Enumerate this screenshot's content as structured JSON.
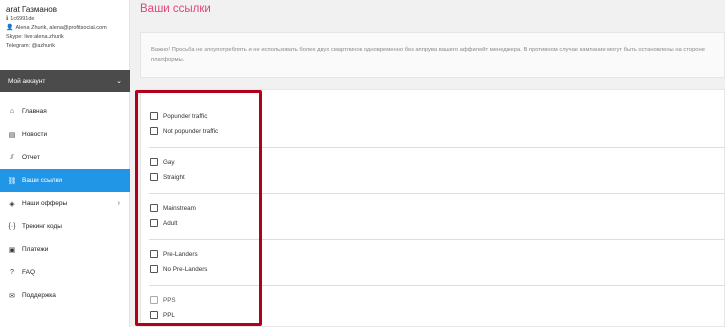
{
  "profile": {
    "name": "arat Газманов",
    "id": "1c6991de",
    "contact": "Alena Zhurik, alena@profitsocial.com",
    "skype": "Skype: live:alena.zhurik",
    "telegram": "Telegram: @azhurik"
  },
  "account": {
    "label": "Мой аккаунт"
  },
  "menu": [
    {
      "label": "Главная",
      "icon": "home-icon",
      "glyph": "⌂"
    },
    {
      "label": "Новости",
      "icon": "news-icon",
      "glyph": "▤"
    },
    {
      "label": "Отчет",
      "icon": "chart-icon",
      "glyph": "⫽"
    },
    {
      "label": "Ваши ссылки",
      "icon": "link-icon",
      "glyph": "⛓"
    },
    {
      "label": "Наши офферы",
      "icon": "offers-icon",
      "glyph": "◈"
    },
    {
      "label": "Трекинг коды",
      "icon": "code-icon",
      "glyph": "{·}"
    },
    {
      "label": "Платежи",
      "icon": "payments-icon",
      "glyph": "▣"
    },
    {
      "label": "FAQ",
      "icon": "help-icon",
      "glyph": "?"
    },
    {
      "label": "Поддержка",
      "icon": "support-icon",
      "glyph": "✉"
    }
  ],
  "main": {
    "title": "Ваши ссылки",
    "notice": "Важно! Просьба не злоупотреблять и не использовать более двух смартлинок одновременно без аппрува вашего аффилейт менеджера. В противном случае кампании могут быть остановлены на стороне платформы."
  },
  "filters": [
    {
      "label": "Popunder traffic",
      "checked": false
    },
    {
      "label": "Not popunder traffic",
      "checked": false
    },
    {
      "label": "Gay",
      "checked": false
    },
    {
      "label": "Straight",
      "checked": false
    },
    {
      "label": "Mainstream",
      "checked": false
    },
    {
      "label": "Adult",
      "checked": false
    },
    {
      "label": "Pre-Landers",
      "checked": false
    },
    {
      "label": "No Pre-Landers",
      "checked": false
    },
    {
      "label": "PPS",
      "checked": false
    },
    {
      "label": "PPL",
      "checked": false
    }
  ],
  "colors": {
    "accent_title": "#e0457b",
    "active_menu": "#2196e6",
    "account_bar": "#4b4b4b",
    "highlight_box": "#b0001a"
  }
}
